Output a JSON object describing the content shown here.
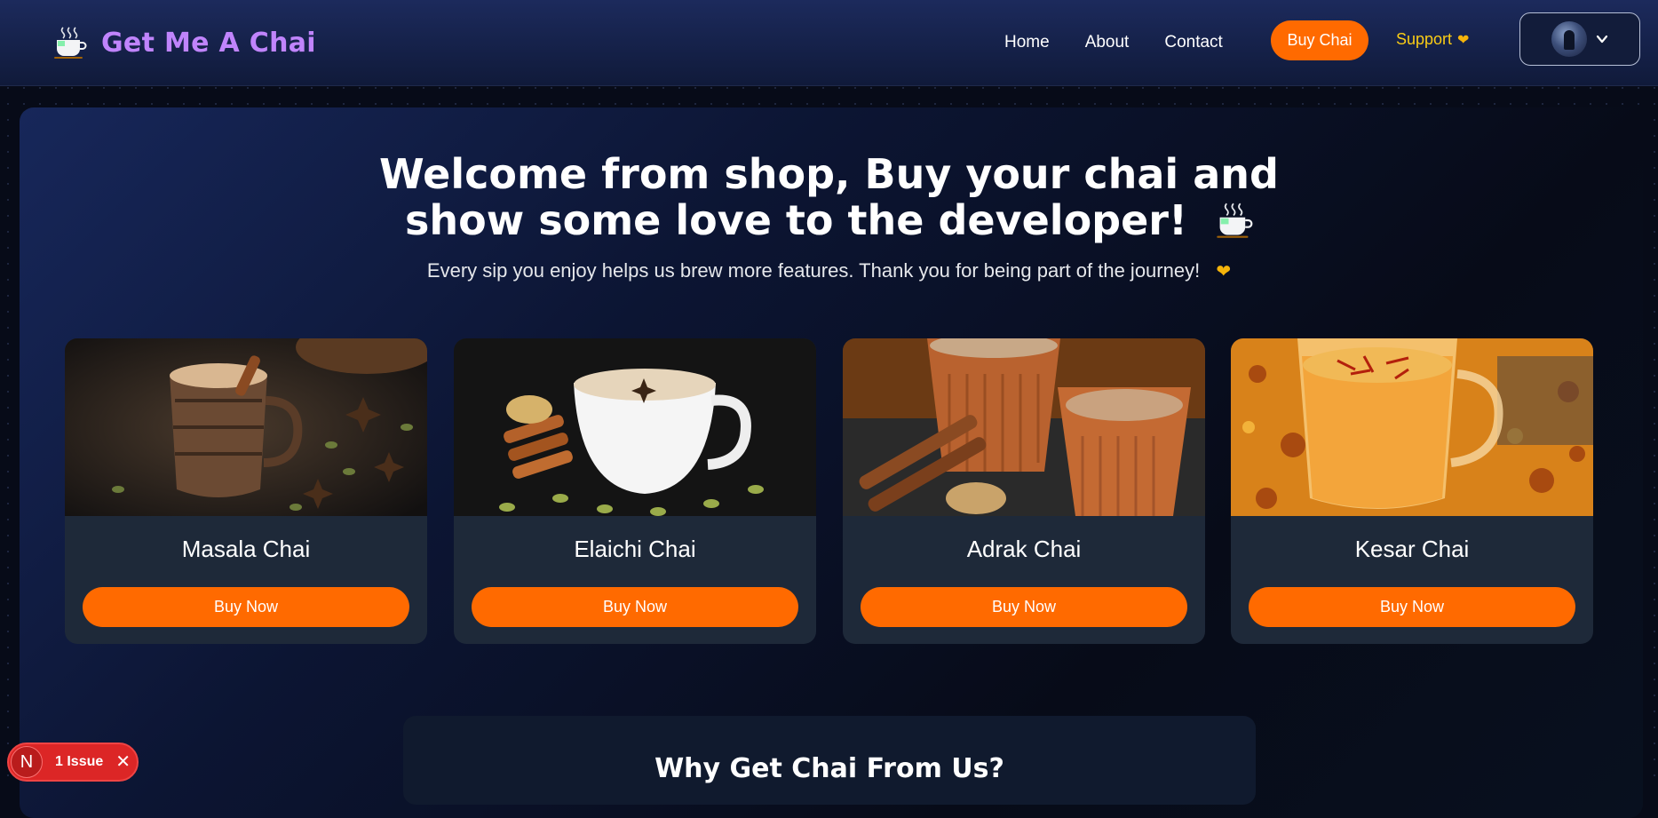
{
  "nav": {
    "brand": "Get Me A Chai",
    "links": [
      "Home",
      "About",
      "Contact"
    ],
    "buy_chai": "Buy Chai",
    "support": "Support",
    "support_icon": "yellow-heart",
    "accent": "#ff6a00",
    "brand_color": "#c084fc"
  },
  "hero": {
    "title_line1": "Welcome from shop, Buy your chai and",
    "title_line2": "show some love to the developer!",
    "subtitle": "Every sip you enjoy helps us brew more features. Thank you for being part of the journey!"
  },
  "cards": [
    {
      "name": "Masala Chai",
      "button": "Buy Now"
    },
    {
      "name": "Elaichi Chai",
      "button": "Buy Now"
    },
    {
      "name": "Adrak Chai",
      "button": "Buy Now"
    },
    {
      "name": "Kesar Chai",
      "button": "Buy Now"
    }
  ],
  "why": {
    "title": "Why Get Chai From Us?"
  },
  "dev_badge": {
    "logo": "N",
    "text": "1 Issue"
  }
}
